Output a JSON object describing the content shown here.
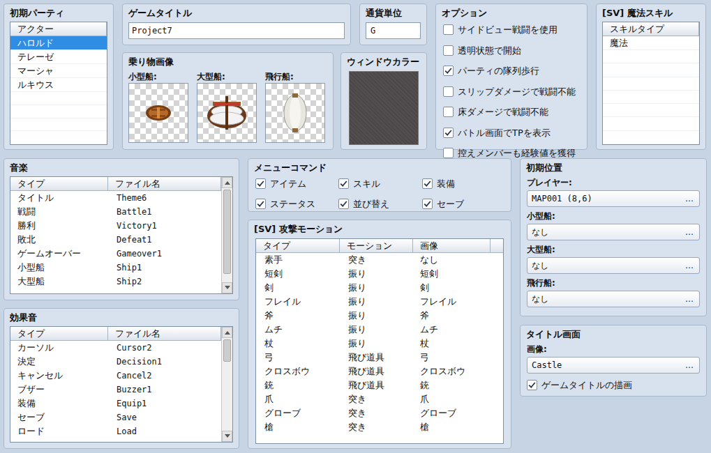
{
  "initial_party": {
    "title": "初期パーティ",
    "column": "アクター",
    "actors": [
      {
        "name": "ハロルド",
        "selected": true
      },
      {
        "name": "テレーゼ",
        "selected": false
      },
      {
        "name": "マーシャ",
        "selected": false
      },
      {
        "name": "ルキウス",
        "selected": false
      }
    ]
  },
  "game_title": {
    "label": "ゲームタイトル",
    "value": "Project7"
  },
  "currency": {
    "label": "通貨単位",
    "value": "G"
  },
  "vehicles": {
    "title": "乗り物画像",
    "items": [
      {
        "label": "小型船:",
        "kind": "boat"
      },
      {
        "label": "大型船:",
        "kind": "ship"
      },
      {
        "label": "飛行船:",
        "kind": "airship"
      }
    ]
  },
  "window_color": {
    "title": "ウィンドウカラー"
  },
  "options": {
    "title": "オプション",
    "items": [
      {
        "label": "サイドビュー戦闘を使用",
        "checked": false
      },
      {
        "label": "透明状態で開始",
        "checked": false
      },
      {
        "label": "パーティの隊列歩行",
        "checked": true
      },
      {
        "label": "スリップダメージで戦闘不能",
        "checked": false
      },
      {
        "label": "床ダメージで戦闘不能",
        "checked": false
      },
      {
        "label": "バトル画面でTPを表示",
        "checked": true
      },
      {
        "label": "控えメンバーも経験値を獲得",
        "checked": false
      }
    ]
  },
  "magic_skills": {
    "title": "[SV] 魔法スキル",
    "column": "スキルタイプ",
    "items": [
      {
        "name": "魔法",
        "selected": false
      }
    ]
  },
  "music": {
    "title": "音楽",
    "columns": [
      "タイプ",
      "ファイル名"
    ],
    "rows": [
      [
        "タイトル",
        "Theme6"
      ],
      [
        "戦闘",
        "Battle1"
      ],
      [
        "勝利",
        "Victory1"
      ],
      [
        "敗北",
        "Defeat1"
      ],
      [
        "ゲームオーバー",
        "Gameover1"
      ],
      [
        "小型船",
        "Ship1"
      ],
      [
        "大型船",
        "Ship2"
      ]
    ],
    "scrollbar": {
      "level": 0.92
    }
  },
  "sound_effects": {
    "title": "効果音",
    "columns": [
      "タイプ",
      "ファイル名"
    ],
    "rows": [
      [
        "カーソル",
        "Cursor2"
      ],
      [
        "決定",
        "Decision1"
      ],
      [
        "キャンセル",
        "Cancel2"
      ],
      [
        "ブザー",
        "Buzzer1"
      ],
      [
        "装備",
        "Equip1"
      ],
      [
        "セーブ",
        "Save"
      ],
      [
        "ロード",
        "Load"
      ]
    ],
    "scrollbar": {
      "level": 0.25
    }
  },
  "menu_commands": {
    "title": "メニューコマンド",
    "items": [
      {
        "label": "アイテム",
        "checked": true
      },
      {
        "label": "スキル",
        "checked": true
      },
      {
        "label": "装備",
        "checked": true
      },
      {
        "label": "ステータス",
        "checked": true
      },
      {
        "label": "並び替え",
        "checked": true
      },
      {
        "label": "セーブ",
        "checked": true
      }
    ]
  },
  "attack_motions": {
    "title": "[SV] 攻撃モーション",
    "columns": [
      "タイプ",
      "モーション",
      "画像"
    ],
    "rows": [
      [
        "素手",
        "突き",
        "なし"
      ],
      [
        "短剣",
        "振り",
        "短剣"
      ],
      [
        "剣",
        "振り",
        "剣"
      ],
      [
        "フレイル",
        "振り",
        "フレイル"
      ],
      [
        "斧",
        "振り",
        "斧"
      ],
      [
        "ムチ",
        "振り",
        "ムチ"
      ],
      [
        "杖",
        "振り",
        "杖"
      ],
      [
        "弓",
        "飛び道具",
        "弓"
      ],
      [
        "クロスボウ",
        "飛び道具",
        "クロスボウ"
      ],
      [
        "銃",
        "飛び道具",
        "銃"
      ],
      [
        "爪",
        "突き",
        "爪"
      ],
      [
        "グローブ",
        "突き",
        "グローブ"
      ],
      [
        "槍",
        "突き",
        "槍"
      ]
    ]
  },
  "start_positions": {
    "title": "初期位置",
    "button": "…",
    "fields": [
      {
        "label": "プレイヤー:",
        "value": "MAP001 (8,6)"
      },
      {
        "label": "小型船:",
        "value": "なし"
      },
      {
        "label": "大型船:",
        "value": "なし"
      },
      {
        "label": "飛行船:",
        "value": "なし"
      }
    ]
  },
  "title_screen": {
    "title": "タイトル画面",
    "image_label": "画像:",
    "image_value": "Castle",
    "button": "…",
    "draw_title": {
      "label": "ゲームタイトルの描画",
      "checked": true
    }
  }
}
